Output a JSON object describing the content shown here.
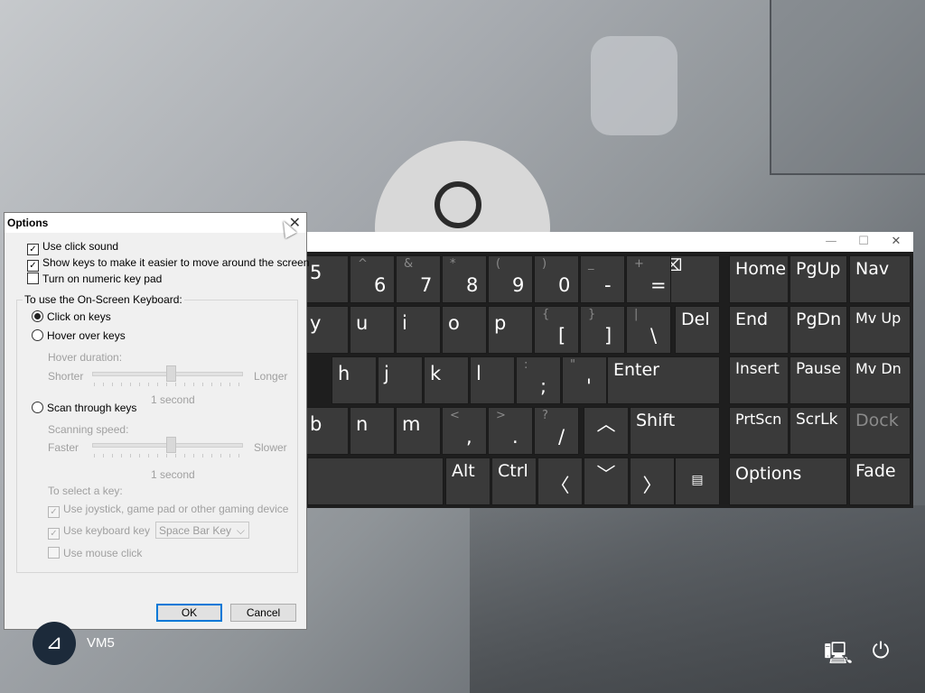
{
  "dialog": {
    "title": "Options",
    "use_click_sound": "Use click sound",
    "show_keys": "Show keys to make it easier to move around the screen",
    "numeric_keypad": "Turn on numeric key pad",
    "group_label": "To use the On-Screen Keyboard:",
    "click_on_keys": "Click on keys",
    "hover_over_keys": "Hover over keys",
    "hover_duration": "Hover duration:",
    "shorter": "Shorter",
    "longer": "Longer",
    "hover_value": "1 second",
    "scan_through_keys": "Scan through keys",
    "scanning_speed": "Scanning speed:",
    "faster": "Faster",
    "slower": "Slower",
    "scan_value": "1 second",
    "select_key_label": "To select a key:",
    "use_joystick": "Use joystick, game pad or other gaming device",
    "use_keyboard_key": "Use keyboard key",
    "keyboard_key_value": "Space Bar Key",
    "use_mouse_click": "Use mouse click",
    "ok": "OK",
    "cancel": "Cancel"
  },
  "keyboard": {
    "row1": [
      {
        "bot": "5",
        "top": ""
      },
      {
        "bot": "6",
        "top": "^"
      },
      {
        "bot": "7",
        "top": "&"
      },
      {
        "bot": "8",
        "top": "*"
      },
      {
        "bot": "9",
        "top": "("
      },
      {
        "bot": "0",
        "top": ")"
      },
      {
        "bot": "-",
        "top": "_"
      },
      {
        "bot": "=",
        "top": "+"
      }
    ],
    "row2": [
      {
        "bot": "y",
        "top": ""
      },
      {
        "bot": "u",
        "top": ""
      },
      {
        "bot": "i",
        "top": ""
      },
      {
        "bot": "o",
        "top": ""
      },
      {
        "bot": "p",
        "top": ""
      },
      {
        "bot": "[",
        "top": "{"
      },
      {
        "bot": "]",
        "top": "}"
      },
      {
        "bot": "\\",
        "top": "|"
      }
    ],
    "row3": [
      {
        "bot": "h",
        "top": ""
      },
      {
        "bot": "j",
        "top": ""
      },
      {
        "bot": "k",
        "top": ""
      },
      {
        "bot": "l",
        "top": ""
      },
      {
        "bot": ";",
        "top": ":"
      },
      {
        "bot": "'",
        "top": "\""
      }
    ],
    "row4": [
      {
        "bot": "b",
        "top": ""
      },
      {
        "bot": "n",
        "top": ""
      },
      {
        "bot": "m",
        "top": ""
      },
      {
        "bot": ",",
        "top": "<"
      },
      {
        "bot": ".",
        "top": ">"
      },
      {
        "bot": "/",
        "top": "?"
      }
    ],
    "del": "Del",
    "enter": "Enter",
    "shift": "Shift",
    "alt": "Alt",
    "ctrl": "Ctrl",
    "home": "Home",
    "pgup": "PgUp",
    "nav": "Nav",
    "end": "End",
    "pgdn": "PgDn",
    "mvup": "Mv Up",
    "insert": "Insert",
    "pause": "Pause",
    "mvdn": "Mv Dn",
    "prtscn": "PrtScn",
    "scrlk": "ScrLk",
    "dock": "Dock",
    "options": "Options",
    "fade": "Fade"
  },
  "login": {
    "username": "VM5"
  }
}
